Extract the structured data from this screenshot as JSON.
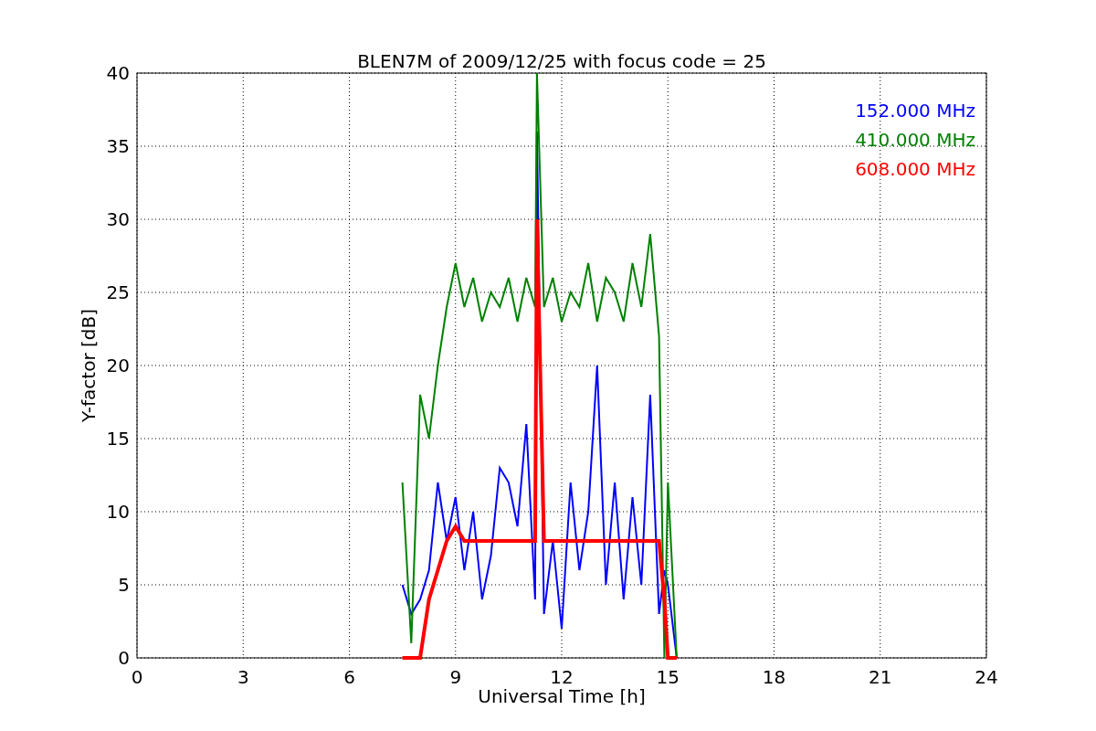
{
  "figure": {
    "chart_data": {
      "type": "line",
      "title": "BLEN7M of 2009/12/25 with focus code = 25",
      "xlabel": "Universal Time [h]",
      "ylabel": "Y-factor [dB]",
      "x": [
        7.5,
        7.75,
        8,
        8.25,
        8.5,
        8.75,
        9,
        9.25,
        9.5,
        9.75,
        10,
        10.25,
        10.5,
        10.75,
        11,
        11.25,
        11.3,
        11.5,
        11.75,
        12,
        12.25,
        12.5,
        12.75,
        13,
        13.25,
        13.5,
        13.75,
        14,
        14.25,
        14.5,
        14.75,
        14.9,
        15,
        15.25
      ],
      "series": [
        {
          "name": "152.000 MHz",
          "color": "#0000ff",
          "values": [
            5,
            3,
            4,
            6,
            12,
            8,
            11,
            6,
            10,
            4,
            7,
            13,
            12,
            9,
            16,
            4,
            36,
            3,
            8,
            2,
            12,
            6,
            10,
            20,
            5,
            12,
            4,
            11,
            5,
            18,
            3,
            6,
            5,
            0
          ]
        },
        {
          "name": "410.000 MHz",
          "color": "#008000",
          "values": [
            12,
            1,
            18,
            15,
            20,
            24,
            27,
            24,
            26,
            23,
            25,
            24,
            26,
            23,
            26,
            24,
            40,
            24,
            26,
            23,
            25,
            24,
            27,
            23,
            26,
            25,
            23,
            27,
            24,
            29,
            22,
            0,
            12,
            0
          ]
        },
        {
          "name": "608.000 MHz",
          "color": "#ff0000",
          "values": [
            0,
            0,
            0,
            4,
            6,
            8,
            9,
            8,
            8,
            8,
            8,
            8,
            8,
            8,
            8,
            8,
            30,
            8,
            8,
            8,
            8,
            8,
            8,
            8,
            8,
            8,
            8,
            8,
            8,
            8,
            8,
            4,
            0,
            0
          ]
        }
      ],
      "grid": true,
      "xlim": [
        0,
        24
      ],
      "ylim": [
        0,
        40
      ],
      "xticks": [
        0,
        3,
        6,
        9,
        12,
        15,
        18,
        21,
        24
      ],
      "yticks": [
        0,
        5,
        10,
        15,
        20,
        25,
        30,
        35,
        40
      ]
    }
  }
}
